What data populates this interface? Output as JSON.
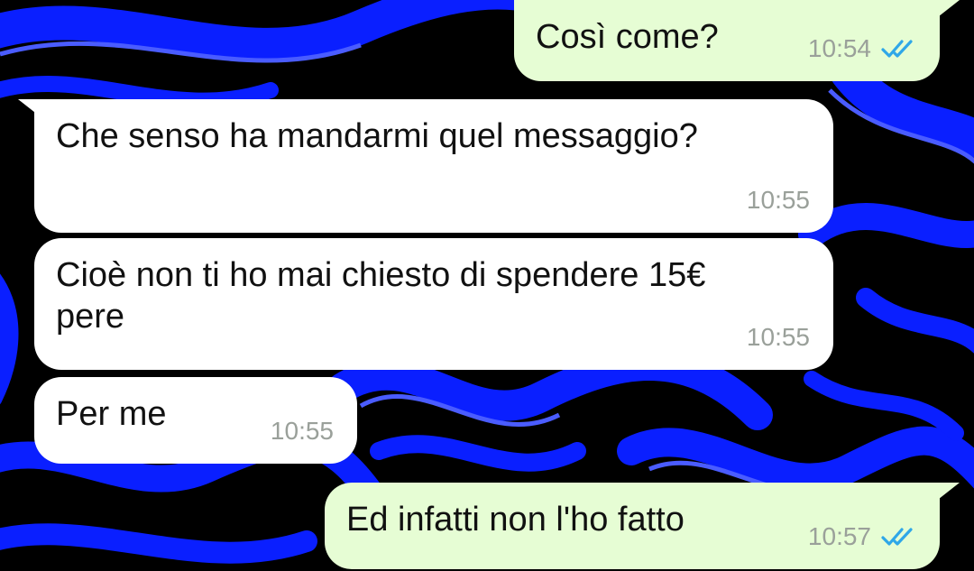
{
  "chat": {
    "wallpaper": {
      "base_color": "#000000",
      "swirl_color": "#0a1fff",
      "swirl_highlight": "#4a5cff"
    },
    "bubble_colors": {
      "incoming": "#ffffff",
      "outgoing": "#e6fdd4",
      "read_ticks": "#2fa7e8"
    },
    "messages": [
      {
        "direction": "outgoing",
        "text": "Così come?",
        "time": "10:54",
        "status": "read"
      },
      {
        "direction": "incoming",
        "text": "Che senso ha mandarmi quel messaggio?",
        "time": "10:55"
      },
      {
        "direction": "incoming",
        "text": "Cioè non ti ho mai chiesto di spendere 15€\npere",
        "time": "10:55"
      },
      {
        "direction": "incoming",
        "text": "Per me",
        "time": "10:55"
      },
      {
        "direction": "outgoing",
        "text": "Ed infatti non l'ho fatto",
        "time": "10:57",
        "status": "read"
      }
    ]
  }
}
